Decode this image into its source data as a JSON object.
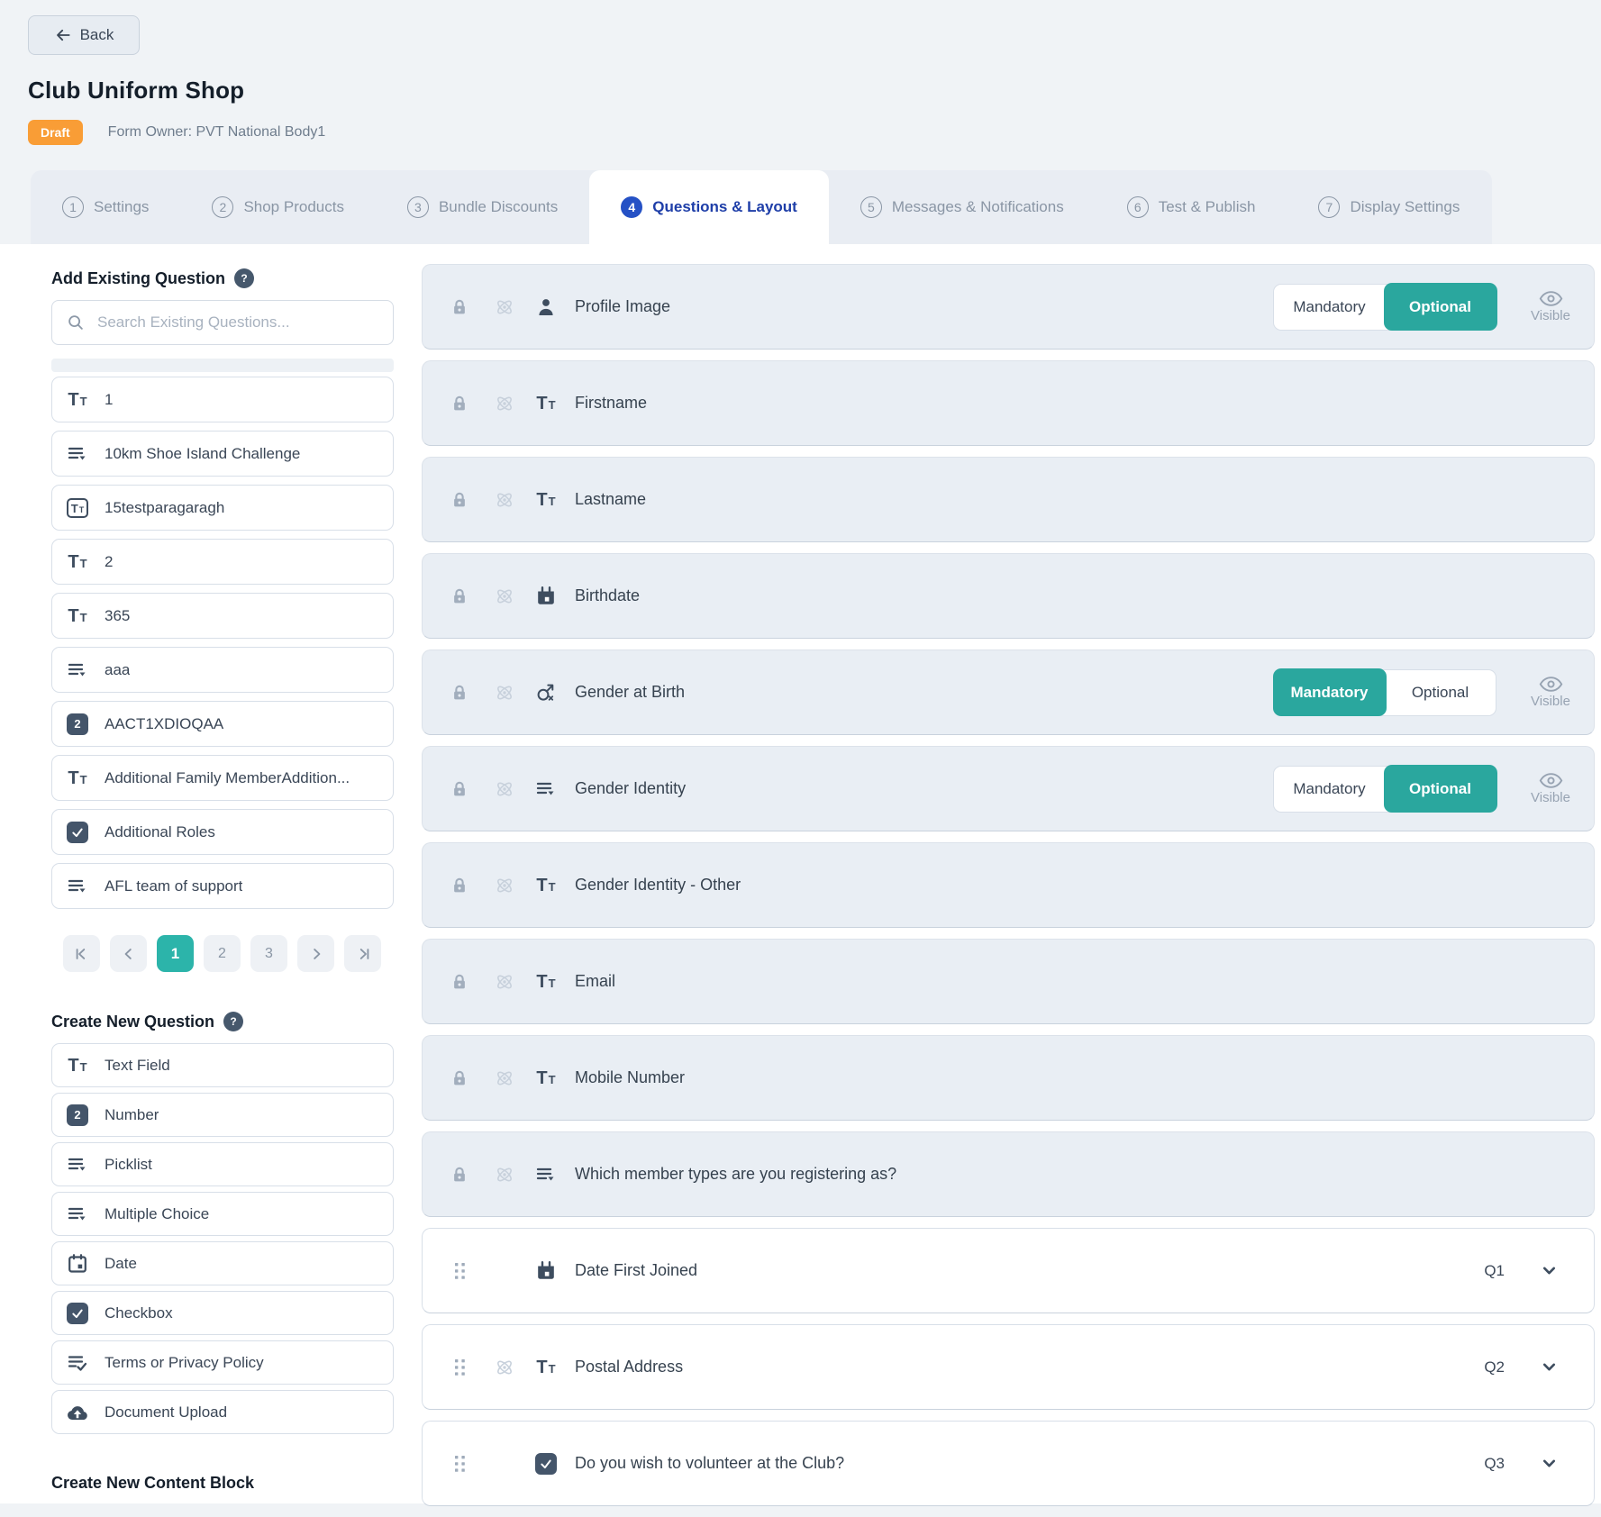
{
  "strings": {
    "back": "Back",
    "visible": "Visible"
  },
  "page": {
    "title": "Club Uniform Shop",
    "status_badge": "Draft",
    "form_owner": "Form Owner: PVT National Body1"
  },
  "colors": {
    "accent_teal": "#2AA79E",
    "pagination_teal": "#2CB4AA",
    "active_tab_blue": "#2551C5",
    "draft_orange": "#F99D36",
    "locked_row_bg": "#E9EEF4"
  },
  "tabs": [
    {
      "number": "1",
      "label": "Settings",
      "active": false
    },
    {
      "number": "2",
      "label": "Shop Products",
      "active": false
    },
    {
      "number": "3",
      "label": "Bundle Discounts",
      "active": false
    },
    {
      "number": "4",
      "label": "Questions & Layout",
      "active": true
    },
    {
      "number": "5",
      "label": "Messages & Notifications",
      "active": false
    },
    {
      "number": "6",
      "label": "Test & Publish",
      "active": false
    },
    {
      "number": "7",
      "label": "Display Settings",
      "active": false
    }
  ],
  "sidebar": {
    "add_existing_heading": "Add Existing Question",
    "search_placeholder": "Search Existing Questions...",
    "existing_questions": [
      {
        "icon": "text-field",
        "label": "1"
      },
      {
        "icon": "picklist",
        "label": "10km Shoe Island Challenge"
      },
      {
        "icon": "paragraph",
        "label": "15testparagaragh"
      },
      {
        "icon": "text-field",
        "label": "2"
      },
      {
        "icon": "text-field",
        "label": "365"
      },
      {
        "icon": "picklist",
        "label": "aaa"
      },
      {
        "icon": "number",
        "label": "AACT1XDIOQAA"
      },
      {
        "icon": "text-field",
        "label": "Additional Family MemberAddition..."
      },
      {
        "icon": "checkbox",
        "label": "Additional Roles"
      },
      {
        "icon": "picklist",
        "label": "AFL team of support"
      }
    ],
    "pagination": {
      "pages": [
        "1",
        "2",
        "3"
      ],
      "active": "1"
    },
    "create_new_heading": "Create New Question",
    "new_question_types": [
      {
        "icon": "text-field",
        "label": "Text Field"
      },
      {
        "icon": "number",
        "label": "Number"
      },
      {
        "icon": "picklist",
        "label": "Picklist"
      },
      {
        "icon": "picklist",
        "label": "Multiple Choice"
      },
      {
        "icon": "date",
        "label": "Date"
      },
      {
        "icon": "checkbox",
        "label": "Checkbox"
      },
      {
        "icon": "terms",
        "label": "Terms or Privacy Policy"
      },
      {
        "icon": "upload",
        "label": "Document Upload"
      }
    ],
    "create_content_heading": "Create New Content Block"
  },
  "toggle_labels": {
    "mandatory": "Mandatory",
    "optional": "Optional"
  },
  "questions": [
    {
      "label": "Profile Image",
      "icon": "profile",
      "locked": true,
      "linked": true,
      "toggle": "optional"
    },
    {
      "label": "Firstname",
      "icon": "text-field",
      "locked": true,
      "linked": true
    },
    {
      "label": "Lastname",
      "icon": "text-field",
      "locked": true,
      "linked": true
    },
    {
      "label": "Birthdate",
      "icon": "date-solid",
      "locked": true,
      "linked": true
    },
    {
      "label": "Gender at Birth",
      "icon": "gender",
      "locked": true,
      "linked": true,
      "toggle": "mandatory"
    },
    {
      "label": "Gender Identity",
      "icon": "picklist",
      "locked": true,
      "linked": true,
      "toggle": "optional"
    },
    {
      "label": "Gender Identity - Other",
      "icon": "text-field",
      "locked": true,
      "linked": true
    },
    {
      "label": "Email",
      "icon": "text-field",
      "locked": true,
      "linked": true
    },
    {
      "label": "Mobile Number",
      "icon": "text-field",
      "locked": true,
      "linked": true
    },
    {
      "label": "Which member types are you registering as?",
      "icon": "picklist",
      "locked": true,
      "linked": true
    },
    {
      "label": "Date First Joined",
      "icon": "date-solid",
      "locked": false,
      "linked": false,
      "qnum": "Q1"
    },
    {
      "label": "Postal Address",
      "icon": "text-field",
      "locked": false,
      "linked": true,
      "qnum": "Q2"
    },
    {
      "label": "Do you wish to volunteer at the Club?",
      "icon": "checkbox",
      "locked": false,
      "linked": false,
      "qnum": "Q3"
    }
  ]
}
